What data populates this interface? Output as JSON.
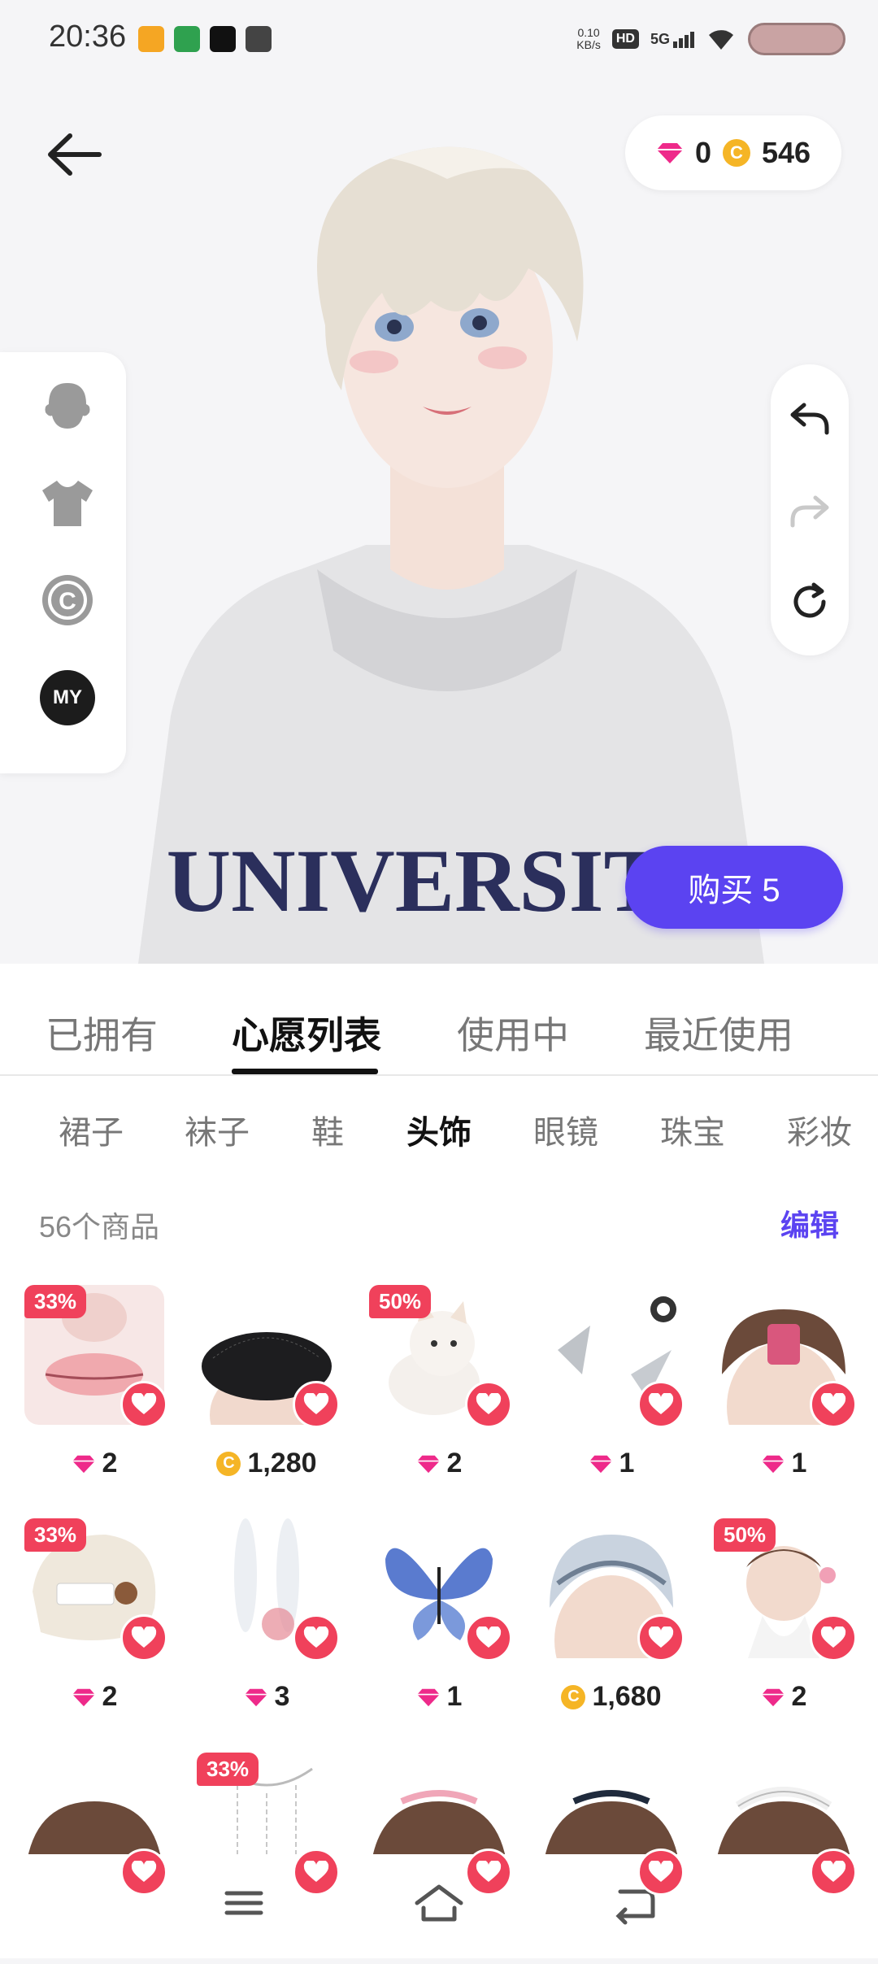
{
  "status_bar": {
    "time": "20:36",
    "net_speed_value": "0.10",
    "net_speed_unit": "KB/s",
    "hd_label": "HD",
    "network_label": "5G"
  },
  "wallet": {
    "diamonds": "0",
    "coin_symbol": "C",
    "coins": "546"
  },
  "left_tools": {
    "my_label": "MY"
  },
  "buy_button": {
    "label": "购买 5"
  },
  "tabs": [
    {
      "label": "已拥有"
    },
    {
      "label": "心愿列表"
    },
    {
      "label": "使用中"
    },
    {
      "label": "最近使用"
    }
  ],
  "categories": [
    {
      "label": "裙子"
    },
    {
      "label": "袜子"
    },
    {
      "label": "鞋"
    },
    {
      "label": "头饰"
    },
    {
      "label": "眼镜"
    },
    {
      "label": "珠宝"
    },
    {
      "label": "彩妆"
    }
  ],
  "item_count": "56个商品",
  "edit_label": "编辑",
  "items": [
    {
      "badge": "33%",
      "currency": "diamond",
      "price": "2",
      "thumb": "lips"
    },
    {
      "badge": "",
      "currency": "coin",
      "price": "1,280",
      "thumb": "beret"
    },
    {
      "badge": "50%",
      "currency": "diamond",
      "price": "2",
      "thumb": "cat"
    },
    {
      "badge": "",
      "currency": "diamond",
      "price": "1",
      "thumb": "earrings"
    },
    {
      "badge": "",
      "currency": "diamond",
      "price": "1",
      "thumb": "hair-clip"
    },
    {
      "badge": "33%",
      "currency": "diamond",
      "price": "2",
      "thumb": "knit-hat"
    },
    {
      "badge": "",
      "currency": "diamond",
      "price": "3",
      "thumb": "blush"
    },
    {
      "badge": "",
      "currency": "diamond",
      "price": "1",
      "thumb": "butterfly"
    },
    {
      "badge": "",
      "currency": "coin",
      "price": "1,680",
      "thumb": "bonnet"
    },
    {
      "badge": "50%",
      "currency": "diamond",
      "price": "2",
      "thumb": "veil"
    },
    {
      "badge": "",
      "thumb": "hair"
    },
    {
      "badge": "33%",
      "thumb": "chain"
    },
    {
      "badge": "",
      "thumb": "pink-ribbon"
    },
    {
      "badge": "",
      "thumb": "black-ribbon"
    },
    {
      "badge": "",
      "thumb": "headband"
    }
  ],
  "colors": {
    "accent": "#5b43f1",
    "badge": "#f0415b",
    "heart": "#f0415b",
    "diamond": "#ee2a8a",
    "coin": "#f5b526"
  }
}
